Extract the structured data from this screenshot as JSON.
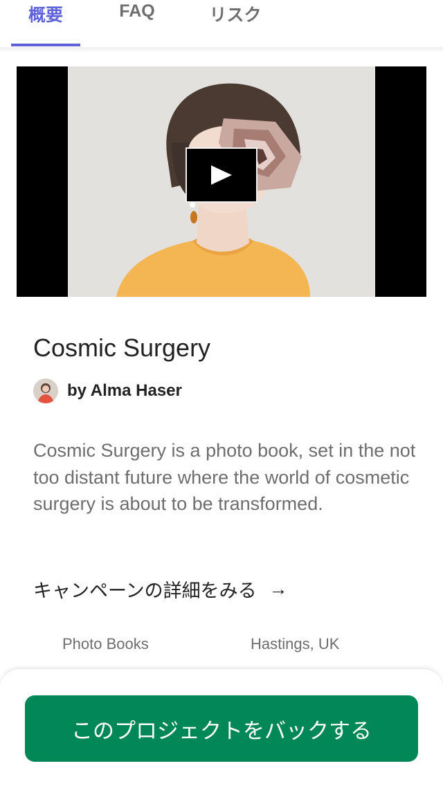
{
  "tabs": {
    "overview": "概要",
    "faq": "FAQ",
    "risks": "リスク"
  },
  "colors": {
    "tab_active": "#5f63d9",
    "cta_green": "#028858",
    "text_primary": "#222222",
    "text_secondary": "#6d6d6d"
  },
  "video": {
    "play_icon": "play-icon"
  },
  "project": {
    "title": "Cosmic Surgery",
    "creator": "by Alma Haser",
    "blurb": "Cosmic Surgery is a photo book, set in the not too distant future where the world of cosmetic surgery is about to be transformed.",
    "campaign_link": "キャンペーンの詳細をみる",
    "campaign_arrow": "→",
    "category": "Photo Books",
    "location": "Hastings, UK"
  },
  "cta": {
    "label": "このプロジェクトをバックする"
  }
}
